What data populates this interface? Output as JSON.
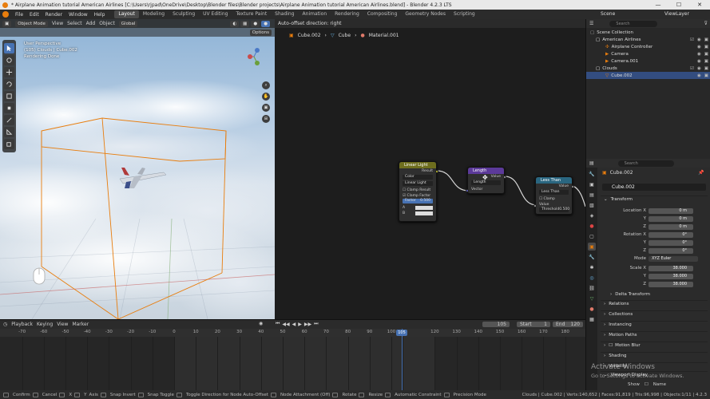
{
  "window": {
    "title": "* Airplane Animation tutorial American Airlines [C:\\Users\\rjpad\\OneDrive\\Desktop\\Blender files\\Blender projects\\Airplane Animation tutorial American Airlines.blend] - Blender 4.2.3 LTS",
    "minimize": "—",
    "maximize": "☐",
    "close": "✕"
  },
  "menu": {
    "items": [
      "File",
      "Edit",
      "Render",
      "Window",
      "Help"
    ],
    "workspaces": [
      "Layout",
      "Modeling",
      "Sculpting",
      "UV Editing",
      "Texture Paint",
      "Shading",
      "Animation",
      "Rendering",
      "Compositing",
      "Geometry Nodes",
      "Scripting"
    ],
    "active_workspace": "Layout",
    "scene_label": "Scene",
    "view_layer_label": "ViewLayer"
  },
  "viewport": {
    "mode": "Object Mode",
    "menu": [
      "View",
      "Select",
      "Add",
      "Object"
    ],
    "orientation": "Global",
    "options": "Options",
    "info_line1": "User Perspective",
    "info_line2": "(105) Clouds | Cube.002",
    "info_line3": "Rendering Done"
  },
  "node_editor": {
    "status": "Auto-offset direction: right",
    "breadcrumb": [
      "Cube.002",
      "Cube",
      "Material.001"
    ],
    "nodes": {
      "linear_light": {
        "title": "Linear Light",
        "output": "Result",
        "type": "Color",
        "blend": "Linear Light",
        "clamp_result": "Clamp Result",
        "clamp_factor": "Clamp Factor",
        "factor_label": "Factor",
        "factor_value": "0.500",
        "a_label": "A",
        "b_label": "B"
      },
      "length": {
        "title": "Length",
        "output": "Value",
        "op": "Length",
        "input": "Vector"
      },
      "less_than": {
        "title": "Less Than",
        "output": "Value",
        "op": "Less Than",
        "clamp": "Clamp",
        "input": "Value",
        "threshold_label": "Threshold",
        "threshold_value": "0.500"
      }
    }
  },
  "outliner": {
    "search_placeholder": "Search",
    "rows": [
      {
        "label": "Scene Collection",
        "indent": 0
      },
      {
        "label": "American Airlines",
        "indent": 1
      },
      {
        "label": "Airplane Controller",
        "indent": 2
      },
      {
        "label": "Camera",
        "indent": 2
      },
      {
        "label": "Camera.001",
        "indent": 2
      },
      {
        "label": "Clouds",
        "indent": 1
      },
      {
        "label": "Cube.002",
        "indent": 2
      }
    ],
    "selected_row": "Cube.002"
  },
  "properties": {
    "search_placeholder": "Search",
    "object_name": "Cube.002",
    "object_name_field": "Cube.002",
    "transform_title": "Transform",
    "location_label": "Location X",
    "location": [
      "0 m",
      "0 m",
      "0 m"
    ],
    "rotation_label": "Rotation X",
    "rotation": [
      "0°",
      "0°",
      "0°"
    ],
    "mode_label": "Mode",
    "mode_value": "XYZ Euler",
    "scale_label": "Scale X",
    "scale": [
      "38.000",
      "38.000",
      "38.000"
    ],
    "axis_y": "Y",
    "axis_z": "Z",
    "sections": [
      "Delta Transform",
      "Relations",
      "Collections",
      "Instancing",
      "Motion Paths",
      "Motion Blur",
      "Shading",
      "Visibility",
      "Viewport Display"
    ],
    "show_label": "Show",
    "name_label": "Name"
  },
  "timeline": {
    "menus": [
      "Playback",
      "Keying",
      "View",
      "Marker"
    ],
    "current_frame": "105",
    "start_label": "Start",
    "start": "1",
    "end_label": "End",
    "end": "120",
    "ruler": [
      "-70",
      "-60",
      "-50",
      "-40",
      "-30",
      "-20",
      "-10",
      "0",
      "10",
      "20",
      "30",
      "40",
      "50",
      "60",
      "70",
      "80",
      "90",
      "100",
      "105",
      "120",
      "130",
      "140",
      "150",
      "160",
      "170",
      "180"
    ]
  },
  "statusbar": {
    "items": [
      "Confirm",
      "Cancel",
      "X",
      "Y",
      "Axis",
      "Snap Invert",
      "Snap Toggle",
      "Toggle Direction for Node Auto-Offset",
      "Node Attachment (Off)",
      "Rotate",
      "Resize",
      "Automatic Constraint",
      "Precision Mode"
    ],
    "right": "Clouds | Cube.002 | Verts:140,652 | Faces:91,819 | Tris:96,998 | Objects:1/11 | 4.2.3"
  },
  "watermark": {
    "line1": "Activate Windows",
    "line2": "Go to Settings to activate Windows."
  },
  "colors": {
    "accent": "#4772b3",
    "selection": "#e87d0d",
    "node_mix": "#6e6e1e",
    "node_vector_math": "#5c3a9a",
    "node_math": "#2a6680"
  }
}
